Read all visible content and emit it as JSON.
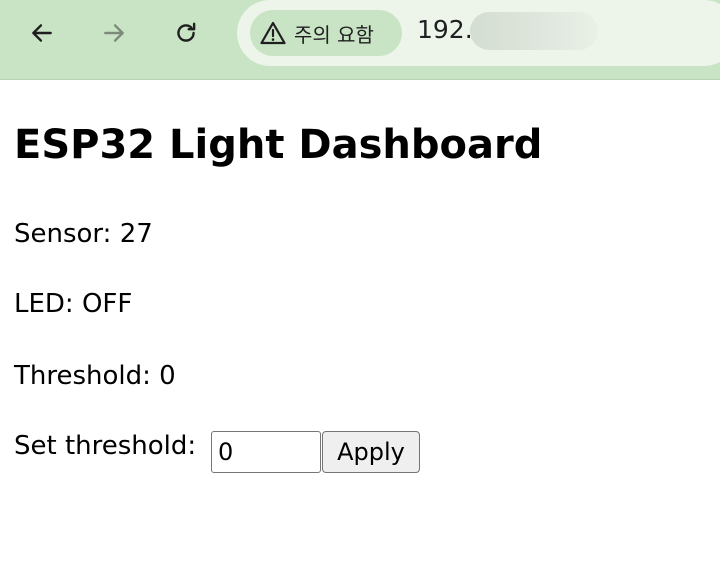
{
  "browser": {
    "security_chip_label": "주의 요함",
    "url_visible": "192."
  },
  "page": {
    "title": "ESP32 Light Dashboard",
    "sensor": {
      "label": "Sensor:",
      "value": "27"
    },
    "led": {
      "label": "LED:",
      "value": "OFF"
    },
    "threshold": {
      "label": "Threshold:",
      "value": "0"
    },
    "form": {
      "label": "Set threshold:",
      "input_value": "0",
      "apply_label": "Apply"
    }
  }
}
